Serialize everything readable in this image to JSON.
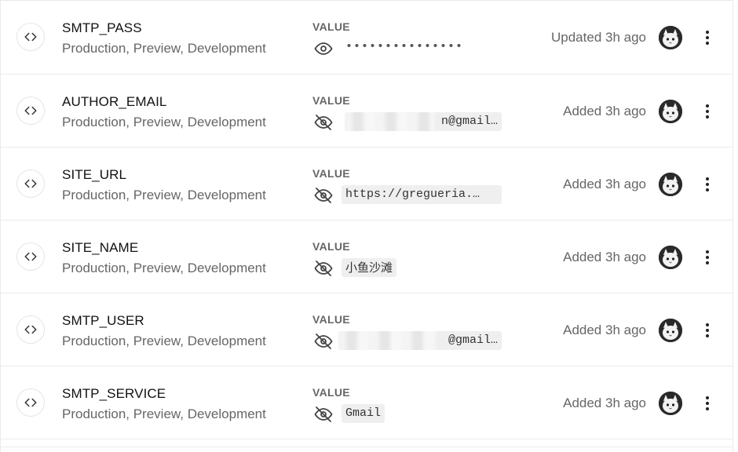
{
  "value_label": "VALUE",
  "envs": [
    {
      "name": "SMTP_PASS",
      "targets": "Production, Preview, Development",
      "visible": true,
      "value": "•••••••••••••••",
      "status": "Updated 3h ago"
    },
    {
      "name": "AUTHOR_EMAIL",
      "targets": "Production, Preview, Development",
      "visible": false,
      "value": "n@gmail…",
      "status": "Added 3h ago"
    },
    {
      "name": "SITE_URL",
      "targets": "Production, Preview, Development",
      "visible": false,
      "value": "https://gregueria.…",
      "status": "Added 3h ago"
    },
    {
      "name": "SITE_NAME",
      "targets": "Production, Preview, Development",
      "visible": false,
      "value": "小鱼沙滩",
      "status": "Added 3h ago"
    },
    {
      "name": "SMTP_USER",
      "targets": "Production, Preview, Development",
      "visible": false,
      "value": "@gmail…",
      "status": "Added 3h ago"
    },
    {
      "name": "SMTP_SERVICE",
      "targets": "Production, Preview, Development",
      "visible": false,
      "value": "Gmail",
      "status": "Added 3h ago"
    }
  ],
  "colors": {
    "border": "#eaeaea",
    "muted_text": "#666666",
    "value_bg": "#efefef"
  },
  "icons": {
    "type": "code-brackets-icon",
    "visible_toggle": "eye-icon",
    "hidden_toggle": "eye-off-icon",
    "avatar": "cat-avatar",
    "menu": "more-vertical-icon"
  }
}
